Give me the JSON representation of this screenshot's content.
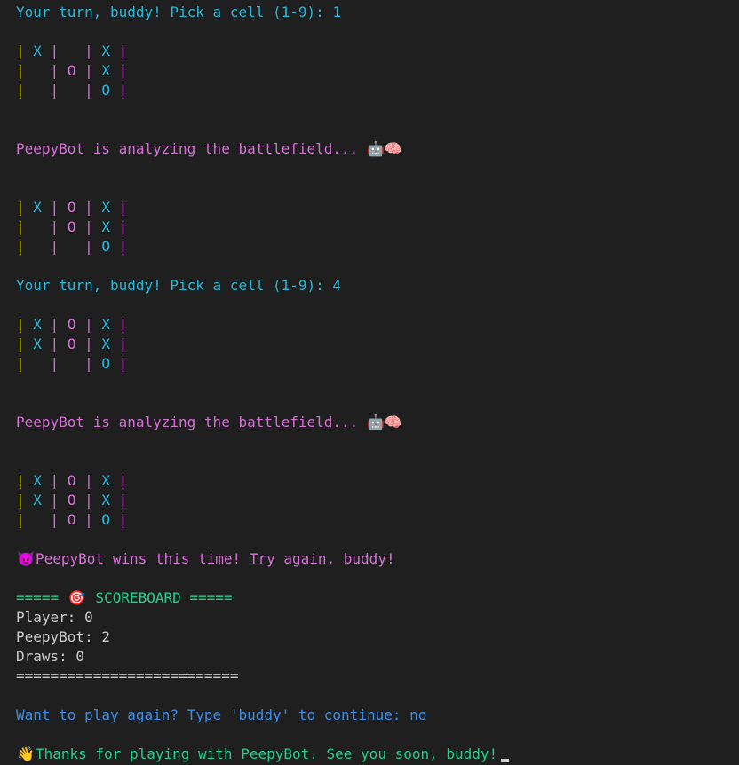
{
  "terminal": {
    "prompt1": "Your turn, buddy! Pick a cell (1-9): ",
    "input1": "1",
    "board1": [
      [
        "X",
        " ",
        "X"
      ],
      [
        " ",
        "O",
        "X"
      ],
      [
        " ",
        " ",
        "O"
      ]
    ],
    "bot_thinking1": "PeepyBot is analyzing the battlefield... ",
    "bot_thinking_icons": "🤖🧠",
    "board2": [
      [
        "X",
        "O",
        "X"
      ],
      [
        " ",
        "O",
        "X"
      ],
      [
        " ",
        " ",
        "O"
      ]
    ],
    "prompt2": "Your turn, buddy! Pick a cell (1-9): ",
    "input2": "4",
    "board3": [
      [
        "X",
        "O",
        "X"
      ],
      [
        "X",
        "O",
        "X"
      ],
      [
        " ",
        " ",
        "O"
      ]
    ],
    "bot_thinking2": "PeepyBot is analyzing the battlefield... ",
    "board4": [
      [
        "X",
        "O",
        "X"
      ],
      [
        "X",
        "O",
        "X"
      ],
      [
        " ",
        "O",
        "O"
      ]
    ],
    "win_icon": "😈",
    "win_message": "PeepyBot wins this time! Try again, buddy!",
    "scoreboard_left": "===== ",
    "scoreboard_icon": "🎯",
    "scoreboard_title": " SCOREBOARD =====",
    "score_player": "Player: 0",
    "score_bot": "PeepyBot: 2",
    "score_draws": "Draws: 0",
    "score_rule": "==========================",
    "again_prompt": "Want to play again? Type 'buddy' to continue: ",
    "again_input": "no",
    "bye_icon": "👋",
    "bye_message": "Thanks for playing with PeepyBot. See you soon, buddy!"
  }
}
